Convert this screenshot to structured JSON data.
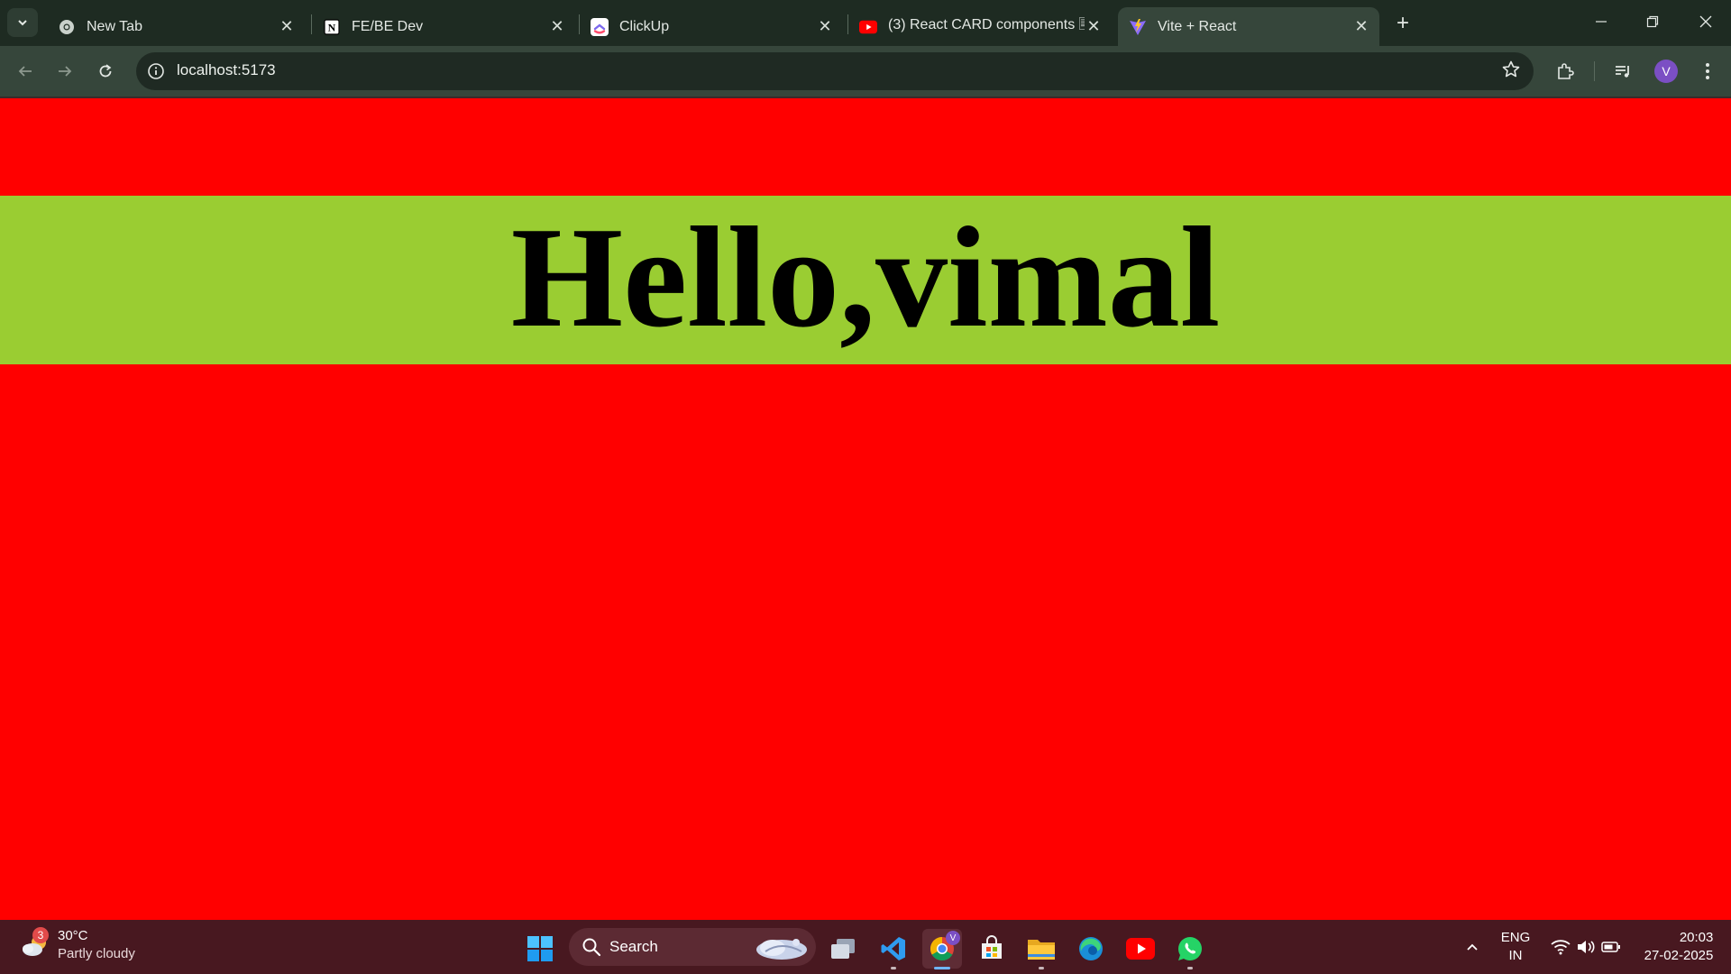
{
  "tabs": [
    {
      "title": "New Tab",
      "icon": "chrome-icon",
      "active": false
    },
    {
      "title": "FE/BE Dev",
      "icon": "notion-icon",
      "active": false
    },
    {
      "title": "ClickUp",
      "icon": "clickup-icon",
      "active": false
    },
    {
      "title": "(3) React CARD components 🗏",
      "icon": "youtube-icon",
      "active": false
    },
    {
      "title": "Vite + React",
      "icon": "vite-icon",
      "active": true
    }
  ],
  "toolbar": {
    "url": "localhost:5173",
    "profile_initial": "V"
  },
  "page": {
    "heading": "Hello,vimal",
    "background_color": "#ff0000",
    "banner_color": "#9acd32"
  },
  "taskbar": {
    "weather": {
      "temp": "30°C",
      "condition": "Partly cloudy",
      "badge": "3"
    },
    "search_label": "Search",
    "chrome_badge": "V",
    "language": {
      "line1": "ENG",
      "line2": "IN"
    },
    "clock": {
      "time": "20:03",
      "date": "27-02-2025"
    }
  }
}
